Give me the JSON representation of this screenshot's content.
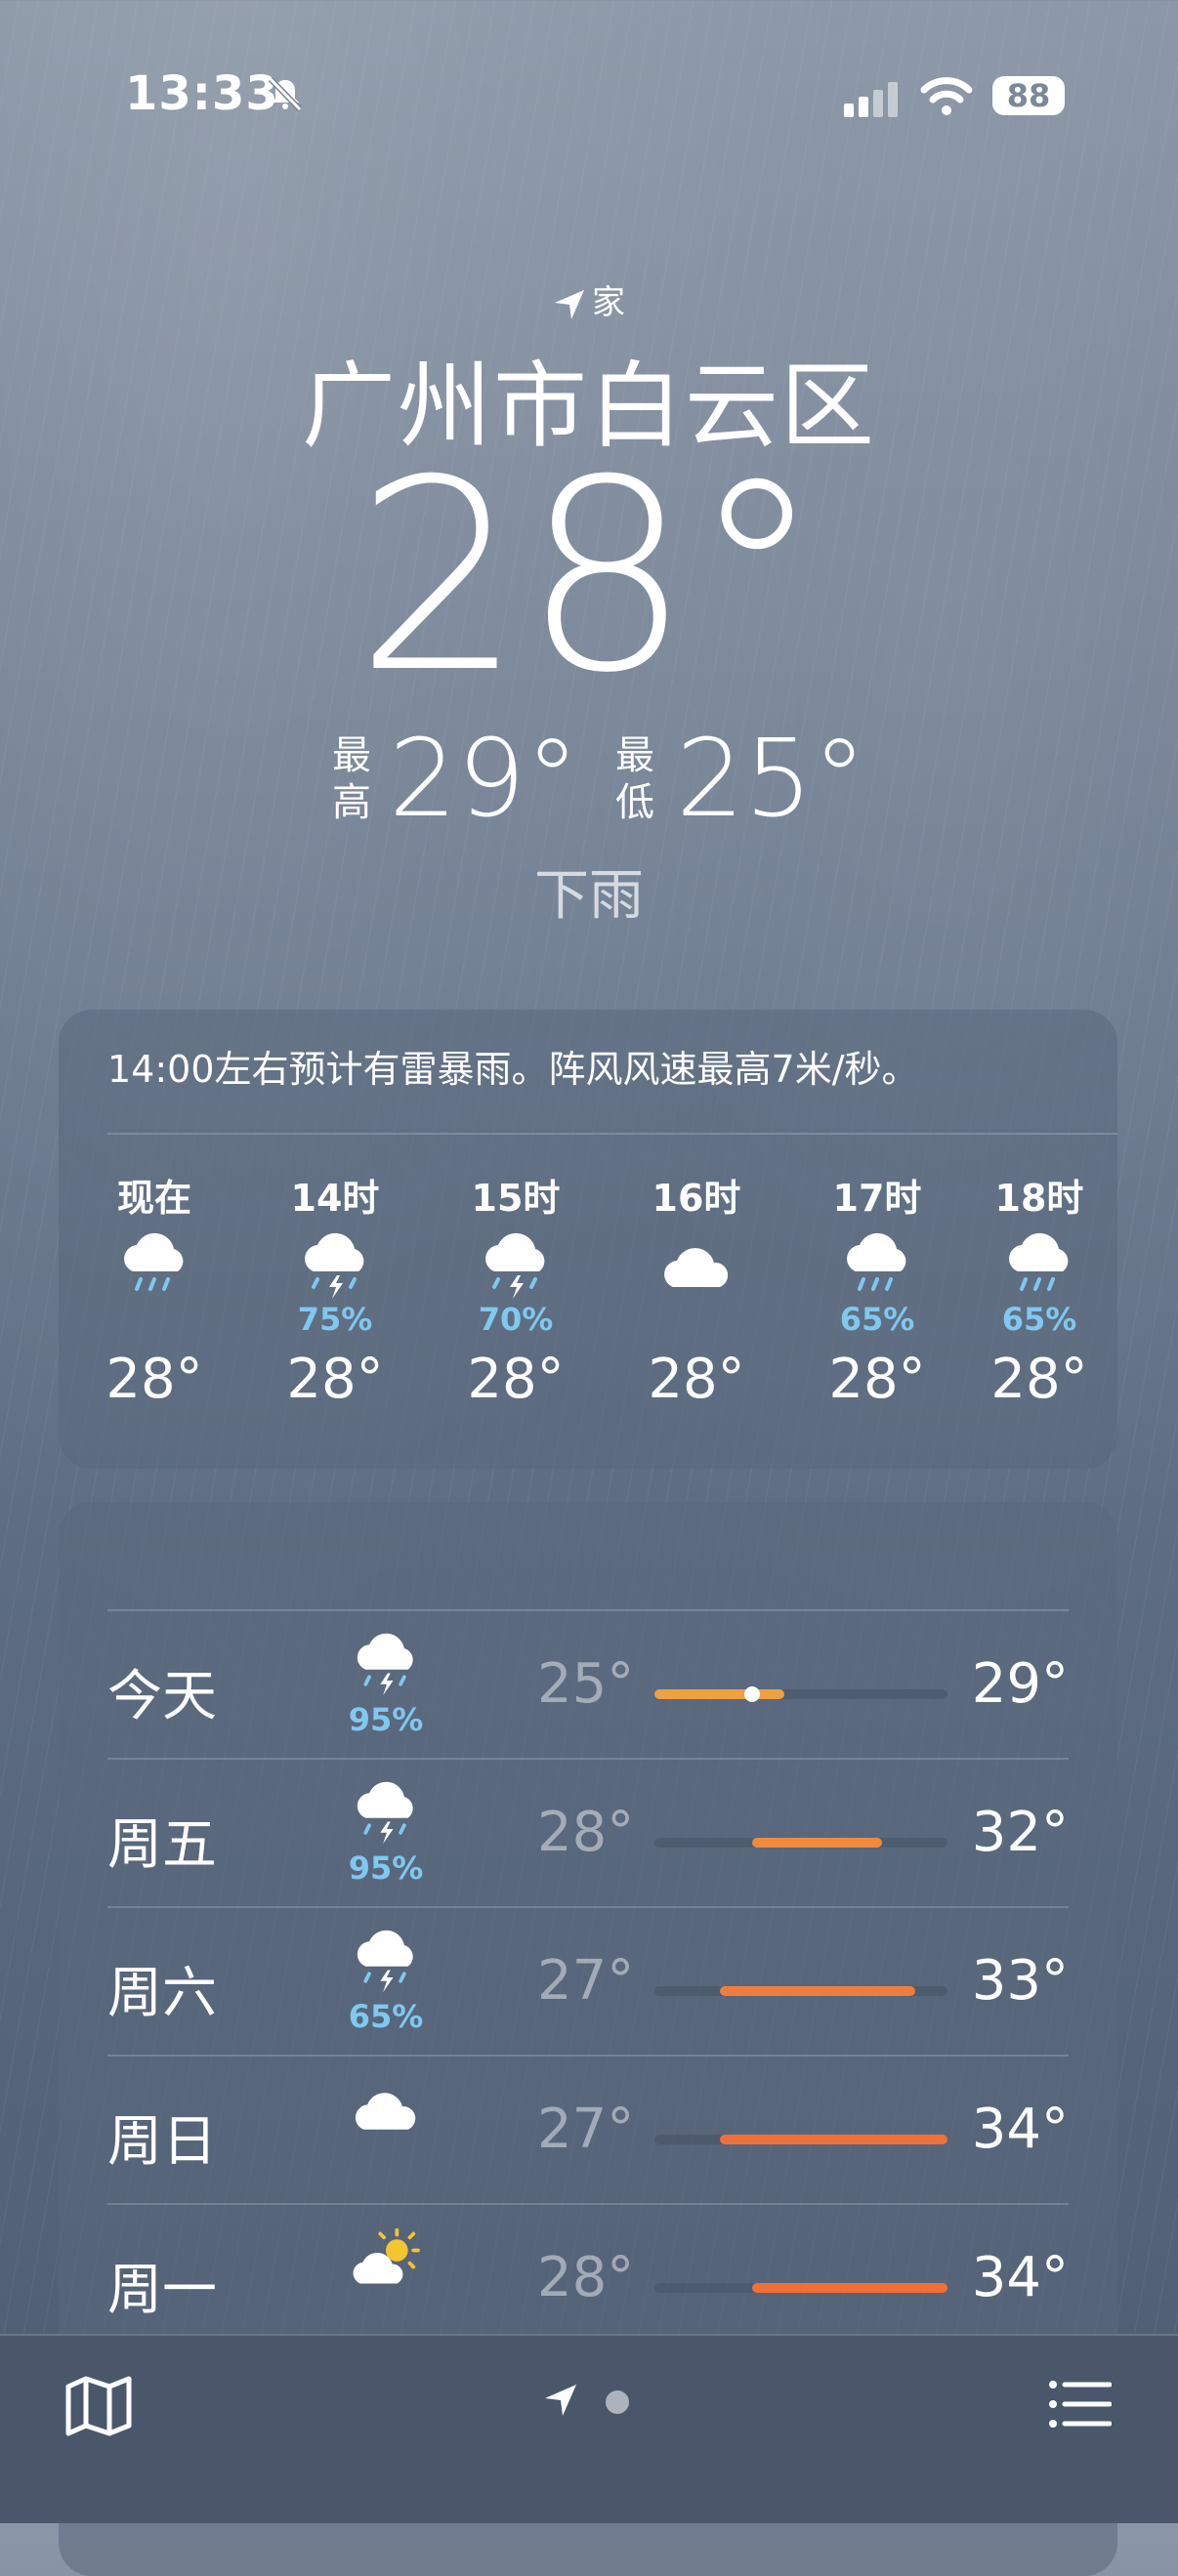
{
  "status": {
    "time": "13:33",
    "battery": "88"
  },
  "location": {
    "label": "家",
    "city": "广州市白云区",
    "current_temp": "28°",
    "high_label": "最高",
    "high": "29°",
    "low_label": "最低",
    "low": "25°",
    "condition": "下雨"
  },
  "hourly": {
    "message": "14:00左右预计有雷暴雨。阵风风速最高7米/秒。",
    "items": [
      {
        "time": "现在",
        "icon": "rain-cloud-icon",
        "precip": "",
        "temp": "28°"
      },
      {
        "time": "14时",
        "icon": "thunderstorm-icon",
        "precip": "75%",
        "temp": "28°"
      },
      {
        "time": "15时",
        "icon": "thunderstorm-icon",
        "precip": "70%",
        "temp": "28°"
      },
      {
        "time": "16时",
        "icon": "cloud-icon",
        "precip": "",
        "temp": "28°"
      },
      {
        "time": "17时",
        "icon": "rain-cloud-icon",
        "precip": "65%",
        "temp": "28°"
      },
      {
        "time": "18时",
        "icon": "rain-cloud-icon",
        "precip": "65%",
        "temp": "28°"
      }
    ]
  },
  "daily": {
    "range_min": 25,
    "range_max": 34,
    "items": [
      {
        "day": "今天",
        "icon": "thunderstorm-icon",
        "precip": "95%",
        "low": "25°",
        "high": "29°",
        "low_val": 25,
        "high_val": 29,
        "current_val": 28,
        "bar_color": "#f0a040"
      },
      {
        "day": "周五",
        "icon": "thunderstorm-icon",
        "precip": "95%",
        "low": "28°",
        "high": "32°",
        "low_val": 28,
        "high_val": 32,
        "bar_color": "#f08a3c"
      },
      {
        "day": "周六",
        "icon": "thunderstorm-icon",
        "precip": "65%",
        "low": "27°",
        "high": "33°",
        "low_val": 27,
        "high_val": 33,
        "bar_color": "#f07e3a"
      },
      {
        "day": "周日",
        "icon": "cloud-icon",
        "precip": "",
        "low": "27°",
        "high": "34°",
        "low_val": 27,
        "high_val": 34,
        "bar_color": "#f07038"
      },
      {
        "day": "周一",
        "icon": "partly-sunny-icon",
        "precip": "",
        "low": "28°",
        "high": "34°",
        "low_val": 28,
        "high_val": 34,
        "bar_color": "#f07038"
      }
    ]
  },
  "colors": {
    "precip": "#7fc8f0",
    "accent_orange": "#f08a3c"
  }
}
